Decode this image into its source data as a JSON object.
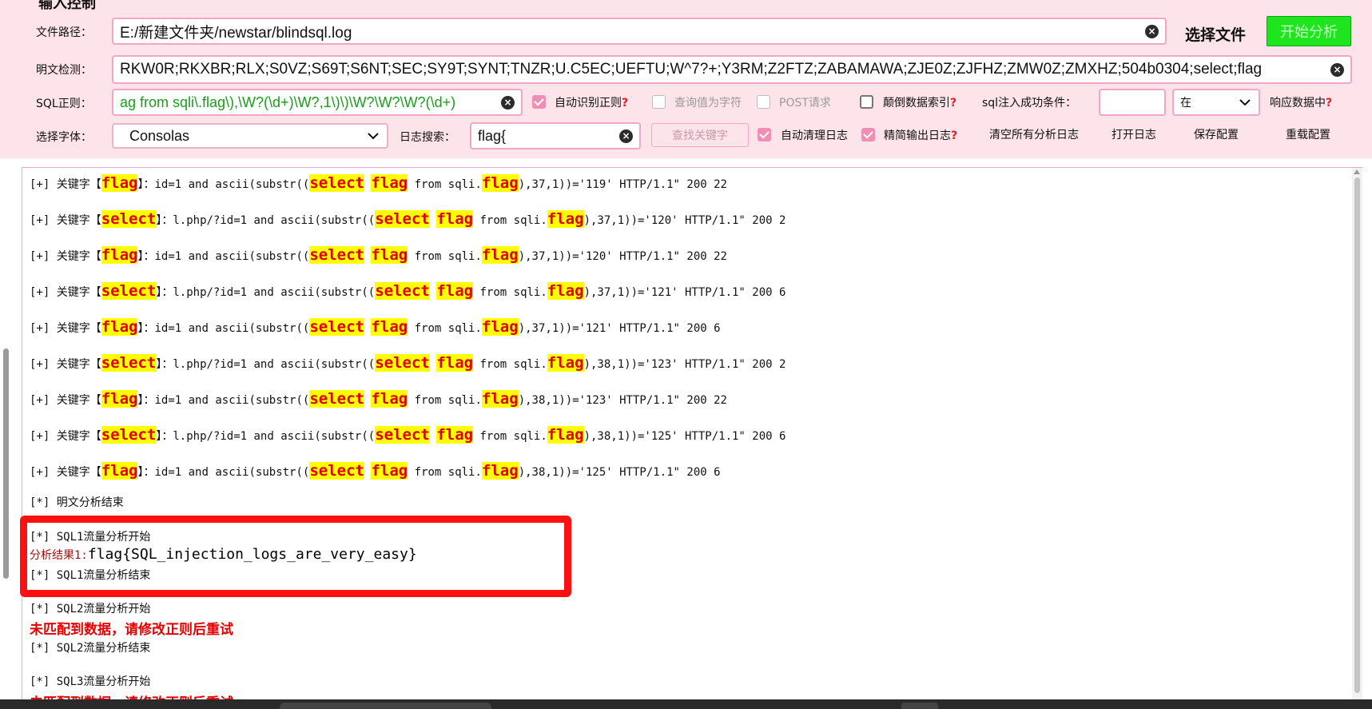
{
  "panel": {
    "title": "输入控制",
    "file_path": {
      "label": "文件路径：",
      "value": "E:/新建文件夹/newstar/blindsql.log"
    },
    "choose_file": "选择文件",
    "start_analysis": "开始分析",
    "plaintext": {
      "label": "明文检测：",
      "value": "RKW0R;RKXBR;RLX;S0VZ;S69T;S6NT;SEC;SY9T;SYNT;TNZR;U.C5EC;UEFTU;W^7?+;Y3RM;Z2FTZ;ZABAMAWA;ZJE0Z;ZJFHZ;ZMW0Z;ZMXHZ;504b0304;select;flag"
    },
    "sql_regex": {
      "label": "SQL正则：",
      "value": "ag from sqli\\.flag\\),\\W?(\\d+)\\W?,1\\)\\)\\W?\\W?\\W?(\\d+)"
    },
    "auto_regex": "自动识别正则",
    "query_as_char": "查询值为字符",
    "post_request": "POST请求",
    "reverse_index": "颠倒数据索引",
    "success_condition": "sql注入成功条件：",
    "condition_value": "",
    "condition_select": "在",
    "response_in": "响应数据中",
    "font": {
      "label": "选择字体：",
      "value": "Consolas"
    },
    "log_search": {
      "label": "日志搜索：",
      "value": "flag{"
    },
    "find_keyword": "查找关键字",
    "auto_clear_log": "自动清理日志",
    "concise_log": "精简输出日志",
    "clear_all_logs": "清空所有分析日志",
    "open_log": "打开日志",
    "save_config": "保存配置",
    "reload_config": "重载配置",
    "question_mark": "?",
    "clear_glyph": "×"
  },
  "log": {
    "prefix_plus": "[+] 关键字【",
    "bracket_close": "】：",
    "rows": [
      {
        "kw": "flag",
        "pre": "id=1 and ascii(substr((",
        "sel": "select",
        "mid": " ",
        "flag1": "flag",
        "from": " from sqli.",
        "flag2": "flag",
        "tail": "),37,1))='119' HTTP/1.1\" 200 22"
      },
      {
        "kw": "select",
        "pre": "l.php/?id=1 and ascii(substr((",
        "sel": "select",
        "mid": " ",
        "flag1": "flag",
        "from": " from sqli.",
        "flag2": "flag",
        "tail": "),37,1))='120' HTTP/1.1\" 200 2"
      },
      {
        "kw": "flag",
        "pre": "id=1 and ascii(substr((",
        "sel": "select",
        "mid": " ",
        "flag1": "flag",
        "from": " from sqli.",
        "flag2": "flag",
        "tail": "),37,1))='120' HTTP/1.1\" 200 22"
      },
      {
        "kw": "select",
        "pre": "l.php/?id=1 and ascii(substr((",
        "sel": "select",
        "mid": " ",
        "flag1": "flag",
        "from": " from sqli.",
        "flag2": "flag",
        "tail": "),37,1))='121' HTTP/1.1\" 200 6"
      },
      {
        "kw": "flag",
        "pre": "id=1 and ascii(substr((",
        "sel": "select",
        "mid": " ",
        "flag1": "flag",
        "from": " from sqli.",
        "flag2": "flag",
        "tail": "),37,1))='121' HTTP/1.1\" 200 6"
      },
      {
        "kw": "select",
        "pre": "l.php/?id=1 and ascii(substr((",
        "sel": "select",
        "mid": " ",
        "flag1": "flag",
        "from": " from sqli.",
        "flag2": "flag",
        "tail": "),38,1))='123' HTTP/1.1\" 200 2"
      },
      {
        "kw": "flag",
        "pre": "id=1 and ascii(substr((",
        "sel": "select",
        "mid": " ",
        "flag1": "flag",
        "from": " from sqli.",
        "flag2": "flag",
        "tail": "),38,1))='123' HTTP/1.1\" 200 22"
      },
      {
        "kw": "select",
        "pre": "l.php/?id=1 and ascii(substr((",
        "sel": "select",
        "mid": " ",
        "flag1": "flag",
        "from": " from sqli.",
        "flag2": "flag",
        "tail": "),38,1))='125' HTTP/1.1\" 200 6"
      },
      {
        "kw": "flag",
        "pre": "id=1 and ascii(substr((",
        "sel": "select",
        "mid": " ",
        "flag1": "flag",
        "from": " from sqli.",
        "flag2": "flag",
        "tail": "),38,1))='125' HTTP/1.1\" 200 6"
      }
    ],
    "plain_end": "[*] 明文分析结束",
    "sql1_start": "[*] SQL1流量分析开始",
    "result_label": "分析结果1:",
    "result_value": "flag{SQL_injection_logs_are_very_easy}",
    "sql1_end": "[*] SQL1流量分析结束",
    "sql2_start": "[*] SQL2流量分析开始",
    "no_match": "未匹配到数据，请修改正则后重试",
    "sql2_end": "[*] SQL2流量分析结束",
    "sql3_start": "[*] SQL3流量分析开始"
  }
}
